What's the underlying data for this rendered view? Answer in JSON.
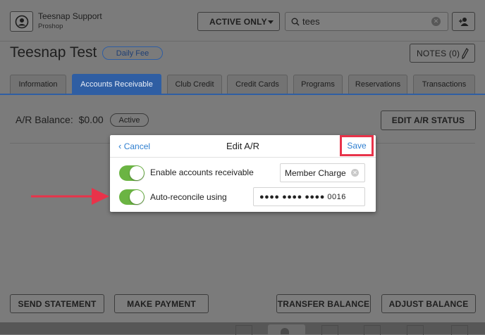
{
  "header": {
    "user_name": "Teesnap Support",
    "user_role": "Proshop",
    "filter_label": "ACTIVE ONLY",
    "search_value": "tees"
  },
  "customer": {
    "name": "Teesnap Test",
    "badge": "Daily Fee",
    "notes_label": "NOTES (0)"
  },
  "tabs": [
    {
      "label": "Information"
    },
    {
      "label": "Accounts Receivable"
    },
    {
      "label": "Club Credit"
    },
    {
      "label": "Credit Cards"
    },
    {
      "label": "Programs"
    },
    {
      "label": "Reservations"
    },
    {
      "label": "Transactions"
    }
  ],
  "ar": {
    "balance_label": "A/R Balance:",
    "balance_value": "$0.00",
    "status": "Active",
    "edit_status_label": "EDIT A/R STATUS"
  },
  "dialog": {
    "cancel_label": "Cancel",
    "title": "Edit A/R",
    "save_label": "Save",
    "enable_label": "Enable accounts receivable",
    "enable_on": true,
    "enable_value": "Member Charge",
    "reconcile_label": "Auto-reconcile using",
    "reconcile_on": true,
    "reconcile_value": "●●●● ●●●● ●●●● 0016"
  },
  "footer": {
    "send_statement": "SEND STATEMENT",
    "make_payment": "MAKE PAYMENT",
    "transfer_balance": "TRANSFER BALANCE",
    "adjust_balance": "ADJUST BALANCE"
  },
  "colors": {
    "annotation_red": "#e8334a",
    "link_blue": "#2f7fd0",
    "toggle_green": "#6bb443",
    "tab_active": "#2f5ea3"
  }
}
